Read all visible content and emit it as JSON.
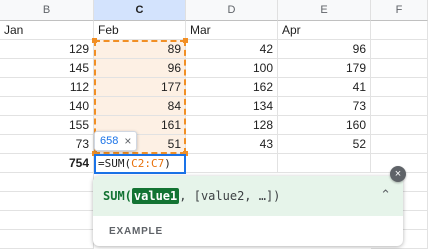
{
  "columns": {
    "b": "B",
    "c": "C",
    "d": "D",
    "e": "E",
    "f": "F"
  },
  "header_row": {
    "b": "Jan",
    "c": "Feb",
    "d": "Mar",
    "e": "Apr"
  },
  "rows": [
    {
      "b": "129",
      "c": "89",
      "d": "42",
      "e": "96"
    },
    {
      "b": "145",
      "c": "96",
      "d": "100",
      "e": "179"
    },
    {
      "b": "112",
      "c": "177",
      "d": "162",
      "e": "41"
    },
    {
      "b": "140",
      "c": "84",
      "d": "134",
      "e": "73"
    },
    {
      "b": "155",
      "c": "161",
      "d": "128",
      "e": "160"
    },
    {
      "b": "73",
      "c": "51",
      "d": "43",
      "e": "52"
    }
  ],
  "total_row": {
    "b": "754"
  },
  "preview_chip": {
    "value": "658",
    "close": "×"
  },
  "editor": {
    "prefix": "=SUM(",
    "ref": "C2:C7",
    "suffix": ")"
  },
  "help_panel": {
    "func": "SUM(",
    "active_arg": "value1",
    "rest": ", [value2, …])",
    "collapse": "⌃",
    "example_label": "EXAMPLE"
  },
  "close_button": "×",
  "colors": {
    "accent": "#1a73e8",
    "range": "#f18f25",
    "range_fill": "#fdf0e4",
    "help_bg": "#e6f4ea"
  }
}
